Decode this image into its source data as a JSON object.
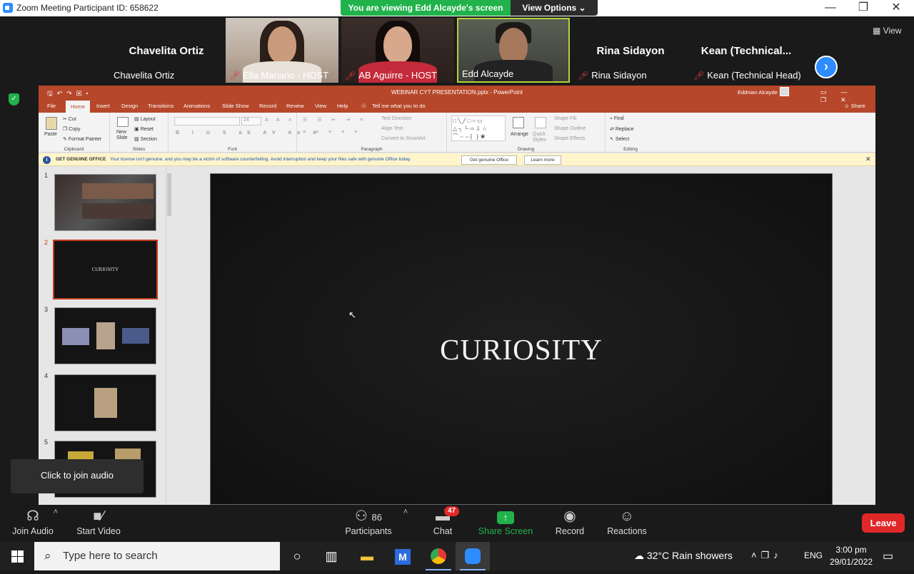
{
  "window": {
    "title": "Zoom Meeting Participant ID: 658622",
    "controls": [
      "—",
      "❐",
      "✕"
    ]
  },
  "share_banner": {
    "status": "You are viewing Edd Alcayde's screen",
    "options": "View Options ⌄"
  },
  "gallery": {
    "view_label": "View",
    "next_icon": "chevron-right-icon",
    "participants": [
      {
        "name": "Chavelita Ortiz",
        "label": "Chavelita Ortiz",
        "video": false,
        "muted": false
      },
      {
        "name": "Ella Mariano - HOST",
        "label": "Ella Mariano - HOST",
        "video": true,
        "muted": true
      },
      {
        "name": "AB Aguirre - HOST",
        "label": "AB Aguirre - HOST",
        "video": true,
        "muted": true
      },
      {
        "name": "Edd Alcayde",
        "label": "Edd Alcayde",
        "video": true,
        "muted": false
      },
      {
        "name": "Rina Sidayon",
        "label": "Rina Sidayon",
        "video": false,
        "muted": true
      },
      {
        "name": "Kean  (Technical...",
        "label": "Kean (Technical Head)",
        "video": false,
        "muted": true
      }
    ]
  },
  "powerpoint": {
    "title": "WEBINAR CYT PRESENTATION.pptx  -  PowerPoint",
    "user": "Eddnian Alcayde",
    "tabs": [
      "File",
      "Home",
      "Insert",
      "Design",
      "Transitions",
      "Animations",
      "Slide Show",
      "Record",
      "Review",
      "View",
      "Help"
    ],
    "tell_me": "Tell me what you to do",
    "share": "Share",
    "ribbon": {
      "clipboard": {
        "label": "Clipboard",
        "paste": "Paste",
        "cut": "Cut",
        "copy": "Copy",
        "format_painter": "Format Painter"
      },
      "slides": {
        "label": "Slides",
        "new_slide": "New Slide",
        "layout": "Layout",
        "reset": "Reset",
        "section": "Section"
      },
      "font": {
        "label": "Font",
        "size": "24"
      },
      "paragraph": {
        "label": "Paragraph",
        "text_direction": "Text Direction",
        "align_text": "Align Text",
        "smartart": "Convert to SmartArt"
      },
      "drawing": {
        "label": "Drawing",
        "arrange": "Arrange",
        "quick_styles": "Quick Styles",
        "shape_fill": "Shape Fill",
        "shape_outline": "Shape Outline",
        "shape_effects": "Shape Effects"
      },
      "editing": {
        "label": "Editing",
        "find": "Find",
        "replace": "Replace",
        "select": "Select"
      }
    },
    "license_bar": {
      "heading": "GET GENUINE OFFICE",
      "message": "Your license isn't genuine, and you may be a victim of software counterfeiting. Avoid interruption and keep your files safe with genuine Office today.",
      "button1": "Get genuine Office",
      "button2": "Learn more"
    },
    "thumbnails": [
      {
        "num": "1",
        "text": ""
      },
      {
        "num": "2",
        "text": "CURIOSITY"
      },
      {
        "num": "3",
        "text": ""
      },
      {
        "num": "4",
        "text": ""
      },
      {
        "num": "5",
        "text": ""
      }
    ],
    "slide_title": "CURIOSITY"
  },
  "tooltip": "Click to join audio",
  "controls": {
    "join_audio": "Join Audio",
    "start_video": "Start Video",
    "participants": "Participants",
    "participant_count": "86",
    "chat": "Chat",
    "chat_badge": "47",
    "share_screen": "Share Screen",
    "record": "Record",
    "reactions": "Reactions",
    "leave": "Leave"
  },
  "taskbar": {
    "search_placeholder": "Type here to search",
    "weather": "32°C  Rain showers",
    "language": "ENG",
    "time": "3:00 pm",
    "date": "29/01/2022"
  },
  "colors": {
    "zoom_blue": "#2d8cff",
    "share_green": "#21b24b",
    "leave_red": "#e02828",
    "ppt_orange": "#b7472a"
  }
}
